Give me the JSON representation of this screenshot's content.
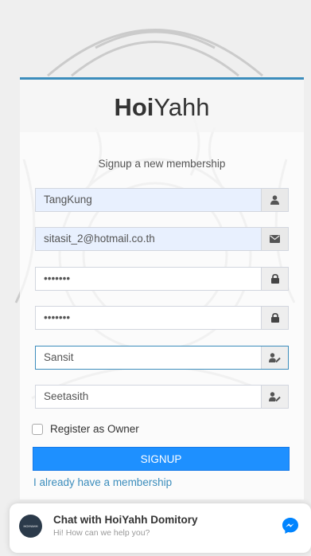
{
  "brand": {
    "bold": "Hoi",
    "regular": "Yahh"
  },
  "subtitle": "Signup a new membership",
  "fields": [
    {
      "value": "TangKung",
      "icon": "user-icon"
    },
    {
      "value": "sitasit_2@hotmail.co.th",
      "icon": "envelope-icon"
    },
    {
      "value": "•••••••",
      "icon": "lock-icon"
    },
    {
      "value": "•••••••",
      "icon": "lock-icon"
    },
    {
      "value": "Sansit",
      "icon": "user-edit-icon"
    },
    {
      "value": "Seetasith",
      "icon": "user-edit-icon"
    }
  ],
  "register_owner_label": "Register as Owner",
  "signup_label": "SIGNUP",
  "membership_link": "I already have a membership",
  "chat": {
    "avatar_text": "HOIYAHH",
    "title": "Chat with HoiYahh Domitory",
    "subtitle": "Hi! How can we help you?"
  },
  "colors": {
    "accent": "#3c8dbc",
    "button": "#1e90ff",
    "messenger": "#0084ff"
  }
}
